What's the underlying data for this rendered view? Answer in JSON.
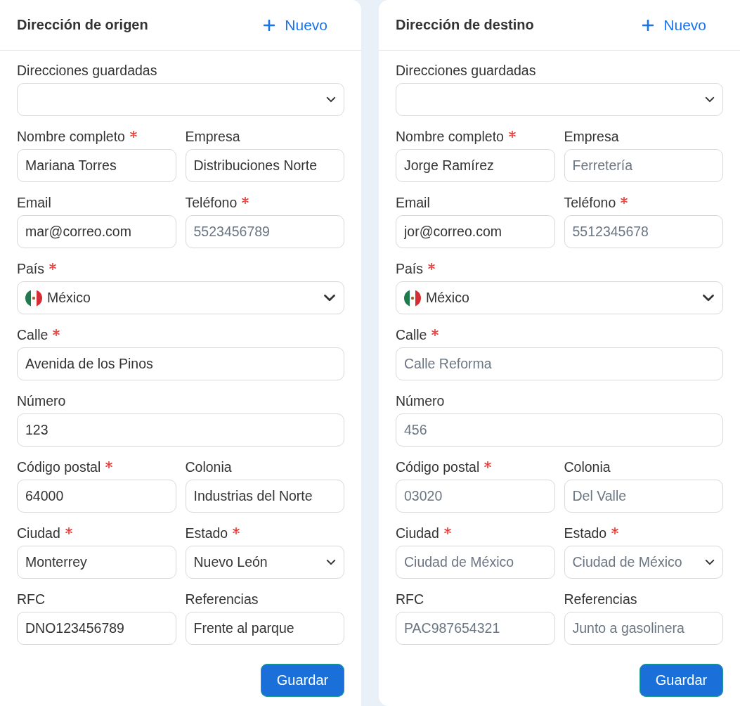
{
  "panels": [
    {
      "title": "Dirección de origen",
      "new_label": "Nuevo",
      "save_label": "Guardar",
      "rows": [
        [
          {
            "kind": "select",
            "label": "Direcciones guardadas",
            "required": false
          }
        ],
        [
          {
            "kind": "text",
            "label": "Nombre completo",
            "required": true,
            "value": "Mariana Torres"
          },
          {
            "kind": "text",
            "label": "Empresa",
            "required": false,
            "value": "Distribuciones Norte"
          }
        ],
        [
          {
            "kind": "text",
            "label": "Email",
            "required": false,
            "value": "mar@correo.com"
          },
          {
            "kind": "text",
            "label": "Teléfono",
            "required": true,
            "placeholder": "5523456789"
          }
        ],
        [
          {
            "kind": "country",
            "label": "País",
            "required": true,
            "value": "México"
          }
        ],
        [
          {
            "kind": "text",
            "label": "Calle",
            "required": true,
            "value": "Avenida de los Pinos"
          }
        ],
        [
          {
            "kind": "text",
            "label": "Número",
            "required": false,
            "value": "123"
          }
        ],
        [
          {
            "kind": "text",
            "label": "Código postal",
            "required": true,
            "value": "64000"
          },
          {
            "kind": "text",
            "label": "Colonia",
            "required": false,
            "value": "Industrias del Norte"
          }
        ],
        [
          {
            "kind": "text",
            "label": "Ciudad",
            "required": true,
            "value": "Monterrey"
          },
          {
            "kind": "select",
            "label": "Estado",
            "required": true,
            "value": "Nuevo León"
          }
        ],
        [
          {
            "kind": "text",
            "label": "RFC",
            "required": false,
            "value": "DNO123456789"
          },
          {
            "kind": "text",
            "label": "Referencias",
            "required": false,
            "value": "Frente al parque"
          }
        ]
      ]
    },
    {
      "title": "Dirección de destino",
      "new_label": "Nuevo",
      "save_label": "Guardar",
      "rows": [
        [
          {
            "kind": "select",
            "label": "Direcciones guardadas",
            "required": false
          }
        ],
        [
          {
            "kind": "text",
            "label": "Nombre completo",
            "required": true,
            "value": "Jorge Ramírez"
          },
          {
            "kind": "text",
            "label": "Empresa",
            "required": false,
            "placeholder": "Ferretería"
          }
        ],
        [
          {
            "kind": "text",
            "label": "Email",
            "required": false,
            "value": "jor@correo.com"
          },
          {
            "kind": "text",
            "label": "Teléfono",
            "required": true,
            "placeholder": "5512345678"
          }
        ],
        [
          {
            "kind": "country",
            "label": "País",
            "required": true,
            "value": "México"
          }
        ],
        [
          {
            "kind": "text",
            "label": "Calle",
            "required": true,
            "placeholder": "Calle Reforma"
          }
        ],
        [
          {
            "kind": "text",
            "label": "Número",
            "required": false,
            "placeholder": "456"
          }
        ],
        [
          {
            "kind": "text",
            "label": "Código postal",
            "required": true,
            "placeholder": "03020"
          },
          {
            "kind": "text",
            "label": "Colonia",
            "required": false,
            "placeholder": "Del Valle"
          }
        ],
        [
          {
            "kind": "text",
            "label": "Ciudad",
            "required": true,
            "placeholder": "Ciudad de México"
          },
          {
            "kind": "select",
            "label": "Estado",
            "required": true,
            "placeholder": "Ciudad de México"
          }
        ],
        [
          {
            "kind": "text",
            "label": "RFC",
            "required": false,
            "placeholder": "PAC987654321"
          },
          {
            "kind": "text",
            "label": "Referencias",
            "required": false,
            "placeholder": "Junto a gasolinera"
          }
        ]
      ]
    }
  ]
}
